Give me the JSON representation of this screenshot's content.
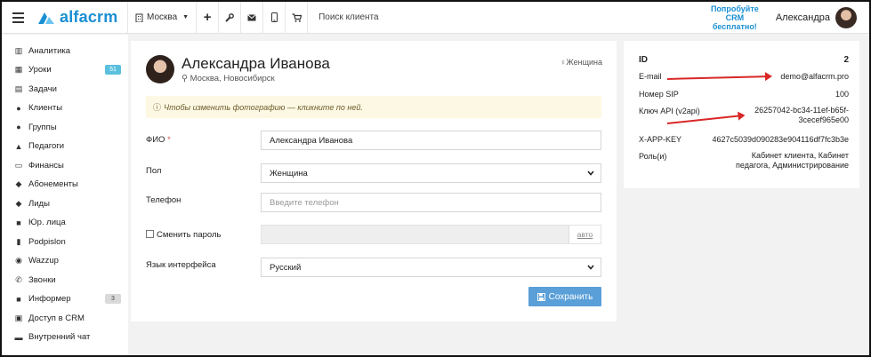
{
  "header": {
    "logo_text": "alfacrm",
    "city": "Москва",
    "search_placeholder": "Поиск клиента",
    "promo_line1": "Попробуйте",
    "promo_line2": "CRM бесплатно!",
    "user_name": "Александра"
  },
  "sidebar": {
    "items": [
      {
        "label": "Аналитика",
        "icon": "chart-icon"
      },
      {
        "label": "Уроки",
        "icon": "calendar-icon",
        "badge": "51"
      },
      {
        "label": "Задачи",
        "icon": "tasks-icon"
      },
      {
        "label": "Клиенты",
        "icon": "user-icon"
      },
      {
        "label": "Группы",
        "icon": "group-icon"
      },
      {
        "label": "Педагоги",
        "icon": "graduation-cap-icon"
      },
      {
        "label": "Финансы",
        "icon": "money-icon"
      },
      {
        "label": "Абонементы",
        "icon": "tag-icon"
      },
      {
        "label": "Лиды",
        "icon": "tag-icon"
      },
      {
        "label": "Юр. лица",
        "icon": "briefcase-icon"
      },
      {
        "label": "Podpislon",
        "icon": "file-icon"
      },
      {
        "label": "Wazzup",
        "icon": "whatsapp-icon"
      },
      {
        "label": "Звонки",
        "icon": "phone-icon"
      },
      {
        "label": "Информер",
        "icon": "informer-icon",
        "badge": "3"
      },
      {
        "label": "Доступ в CRM",
        "icon": "lock-icon"
      },
      {
        "label": "Внутренний чат",
        "icon": "chat-icon"
      }
    ]
  },
  "profile": {
    "name": "Александра Иванова",
    "location": "Москва, Новосибирск",
    "gender": "Женщина",
    "notice": "Чтобы изменить фотографию — кликните по ней."
  },
  "form": {
    "fio_label": "ФИО",
    "fio_required": "*",
    "fio_value": "Александра Иванова",
    "gender_label": "Пол",
    "gender_value": "Женщина",
    "phone_label": "Телефон",
    "phone_placeholder": "Введите телефон",
    "password_label": "Сменить пароль",
    "password_auto": "авто",
    "lang_label": "Язык интерфейса",
    "lang_value": "Русский",
    "save_label": "Сохранить"
  },
  "account": {
    "id_label": "ID",
    "id_value": "2",
    "email_label": "E-mail",
    "email_value": "demo@alfacrm.pro",
    "sip_label": "Номер SIP",
    "sip_value": "100",
    "api_label": "Ключ API (v2api)",
    "api_value_line1": "26257042-bc34-11ef-b65f-",
    "api_value_line2": "3cecef965e00",
    "xapp_label": "X-APP-KEY",
    "xapp_value": "4627c5039d090283e904116df7fc3b3e",
    "roles_label": "Роль(и)",
    "roles_line1": "Кабинет клиента, Кабинет",
    "roles_line2": "педагога, Администрирование"
  },
  "colors": {
    "brand": "#1a8fd3",
    "save_button": "#5a9fd8",
    "annotation_arrow": "#d92727",
    "notice_bg": "#fcf8e3"
  }
}
